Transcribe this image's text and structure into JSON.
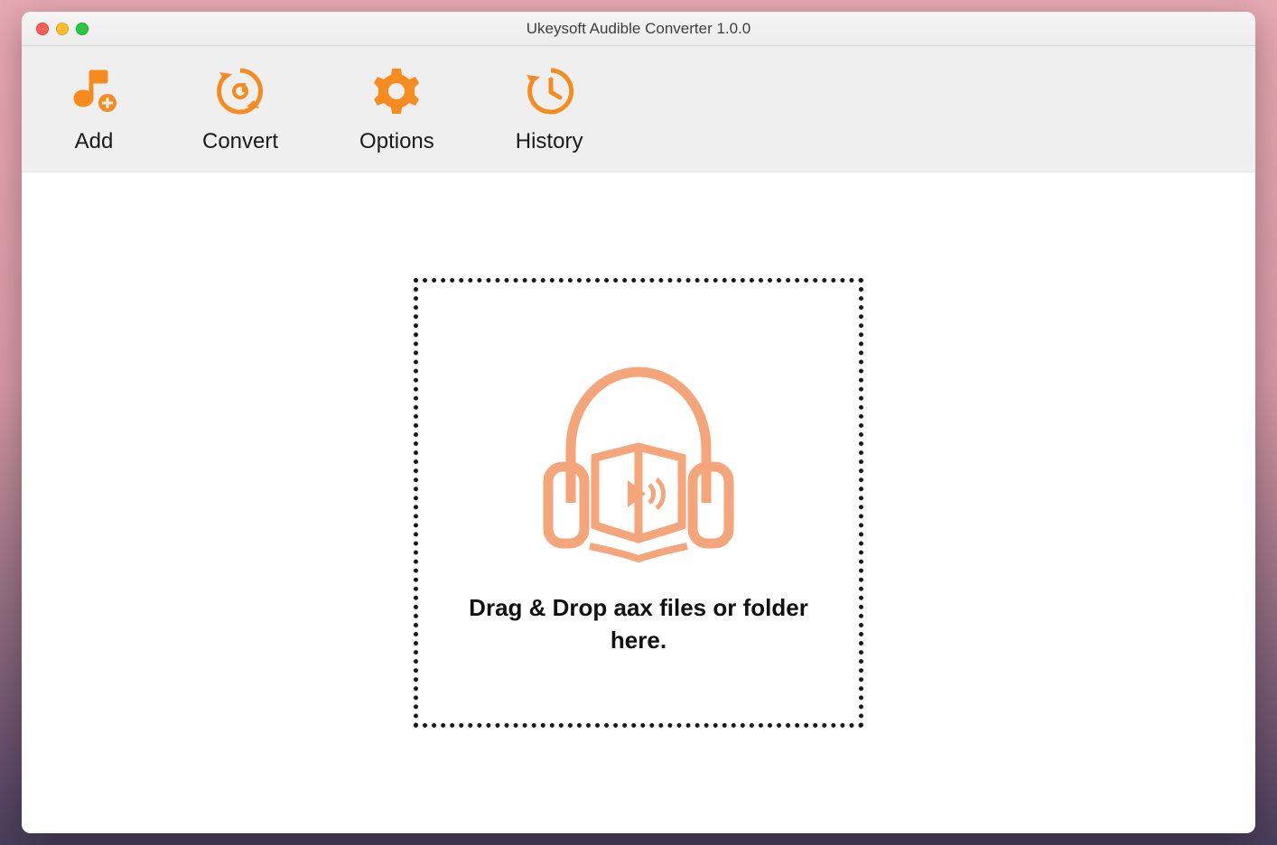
{
  "window": {
    "title": "Ukeysoft Audible Converter 1.0.0"
  },
  "toolbar": {
    "add_label": "Add",
    "convert_label": "Convert",
    "options_label": "Options",
    "history_label": "History"
  },
  "dropzone": {
    "text": "Drag & Drop aax files or folder here."
  },
  "colors": {
    "accent": "#f68b1f",
    "dropzone_icon": "#f4a57a"
  }
}
